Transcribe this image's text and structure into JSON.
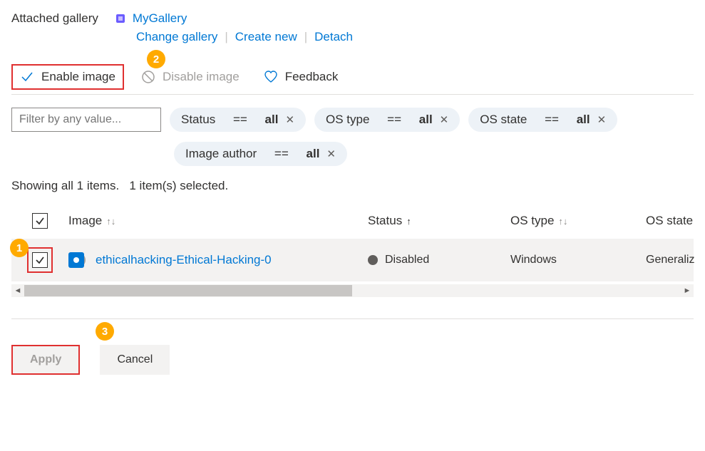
{
  "header": {
    "label": "Attached gallery",
    "gallery_name": "MyGallery",
    "actions": {
      "change": "Change gallery",
      "create": "Create new",
      "detach": "Detach"
    }
  },
  "toolbar": {
    "enable_label": "Enable image",
    "disable_label": "Disable image",
    "feedback_label": "Feedback"
  },
  "filters": {
    "input_placeholder": "Filter by any value...",
    "pills": [
      {
        "field": "Status",
        "op": "==",
        "value": "all"
      },
      {
        "field": "OS type",
        "op": "==",
        "value": "all"
      },
      {
        "field": "OS state",
        "op": "==",
        "value": "all"
      },
      {
        "field": "Image author",
        "op": "==",
        "value": "all"
      }
    ]
  },
  "status_line": {
    "showing": "Showing all 1 items.",
    "selected": "1 item(s) selected."
  },
  "columns": {
    "image": "Image",
    "status": "Status",
    "os_type": "OS type",
    "os_state": "OS state"
  },
  "rows": [
    {
      "name": "ethicalhacking-Ethical-Hacking-0",
      "status": "Disabled",
      "os_type": "Windows",
      "os_state": "Generaliz"
    }
  ],
  "footer": {
    "apply": "Apply",
    "cancel": "Cancel"
  },
  "callouts": {
    "one": "1",
    "two": "2",
    "three": "3"
  }
}
